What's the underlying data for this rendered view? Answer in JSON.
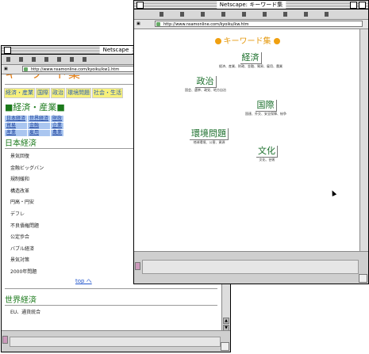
{
  "back_window": {
    "title": "Netscape",
    "location": "http://www.nsamonline.com/kyoiku/kw1.htm",
    "page_title": "キーワード集",
    "tabs": [
      "経済・産業",
      "国際",
      "政治",
      "環境問題",
      "社会・生活"
    ],
    "section_heading": "■経済・産業■",
    "grid": [
      "日本経済",
      "世界経済",
      "財政",
      "貿易",
      "金融",
      "企業",
      "産業",
      "雇用",
      "農業"
    ],
    "sub_heading": "日本経済",
    "items": [
      "景気回復",
      "金融ビッグバン",
      "規制緩和",
      "構造改革",
      "円高・円安",
      "デフレ",
      "不良債権問題",
      "公定歩合",
      "バブル経済",
      "景気対策",
      "2000年問題"
    ],
    "top_link": "top へ",
    "sub_heading2": "世界経済",
    "items2": [
      "EU、通貨統合"
    ]
  },
  "front_window": {
    "title": "Netscape: キーワード集",
    "location": "http://www.nsamonline.com/kyoiku/kw.htm",
    "page_title": "キーワード集",
    "keywords": [
      {
        "label": "経済",
        "sub": "経済、産業、財政、金融、貿易、雇用、農業"
      },
      {
        "label": "政治",
        "sub": "国会、選挙、政党、地方自治"
      },
      {
        "label": "国際",
        "sub": "国連、外交、安全保障、紛争"
      },
      {
        "label": "環境問題",
        "sub": "地球環境、公害、資源"
      },
      {
        "label": "文化",
        "sub": "文化、芸術"
      }
    ]
  },
  "colors": {
    "title_orange": "#e59a10",
    "keyword_green": "#1c6f2c",
    "link_blue": "#2255cc",
    "tab_yellow": "#f7f07a",
    "cell_blue": "#aac6f0"
  }
}
